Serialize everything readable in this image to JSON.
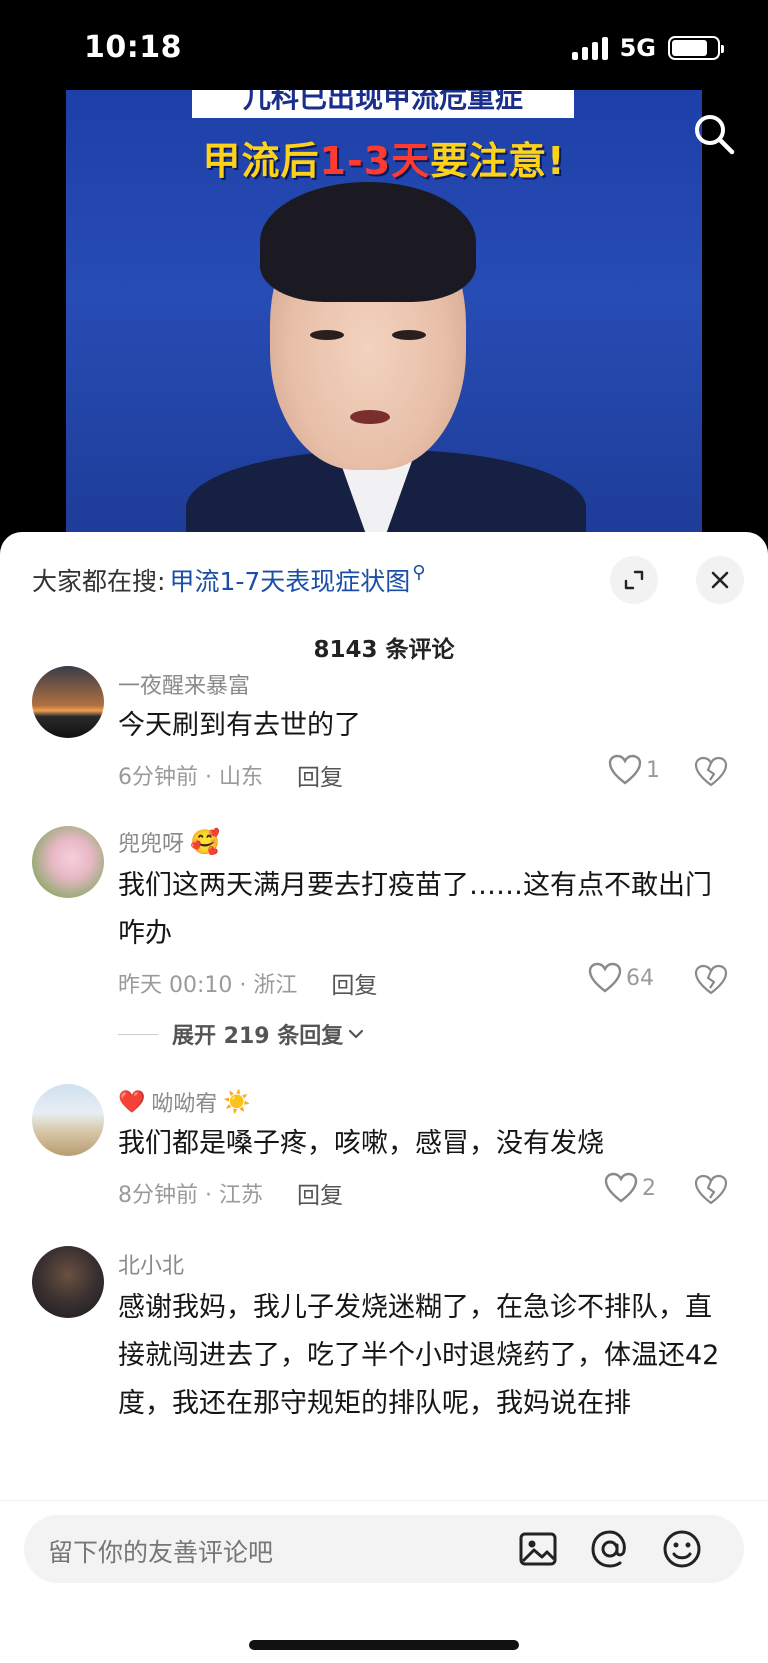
{
  "status_bar": {
    "time": "10:18",
    "network": "5G"
  },
  "video": {
    "banner_top": "儿科已出现甲流危重症",
    "headline_part1": "甲流后",
    "headline_red": "1-3天",
    "headline_part2": "要注意!"
  },
  "sheet": {
    "suggest_label": "大家都在搜:",
    "suggest_query": "甲流1-7天表现症状图",
    "comment_count": "8143 条评论"
  },
  "comments": [
    {
      "user": "一夜醒来暴富",
      "text": "今天刷到有去世的了",
      "time_location": "6分钟前 · 山东",
      "reply_label": "回复",
      "likes": "1"
    },
    {
      "user": "兜兜呀",
      "user_emoji": "🥰",
      "text": "我们这两天满月要去打疫苗了……这有点不敢出门咋办",
      "time_location": "昨天 00:10 · 浙江",
      "reply_label": "回复",
      "likes": "64",
      "expand_replies": "展开 219 条回复"
    },
    {
      "user_prefix": "❤️",
      "user": "呦呦宥",
      "user_emoji": "☀️",
      "text": "我们都是嗓子疼，咳嗽，感冒，没有发烧",
      "time_location": "8分钟前 · 江苏",
      "reply_label": "回复",
      "likes": "2"
    },
    {
      "user": "北小北",
      "text": "感谢我妈，我儿子发烧迷糊了，在急诊不排队，直接就闯进去了，吃了半个小时退烧药了，体温还42度，我还在那守规矩的排队呢，我妈说在排"
    }
  ],
  "input": {
    "placeholder": "留下你的友善评论吧"
  },
  "icons": {
    "search": "search-icon",
    "expand": "expand-icon",
    "close": "close-icon",
    "like": "heart-icon",
    "dislike": "broken-heart-icon",
    "image": "image-icon",
    "mention": "at-icon",
    "emoji": "smiley-icon"
  }
}
